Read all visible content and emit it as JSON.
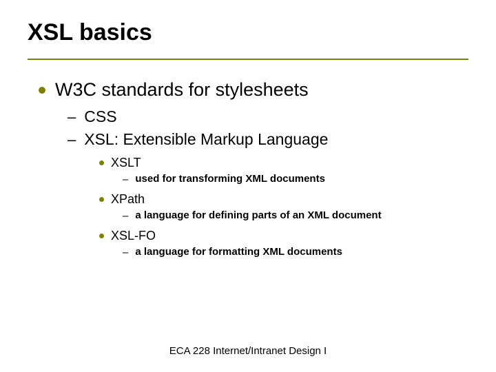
{
  "title": "XSL basics",
  "l1": {
    "text": "W3C standards for stylesheets"
  },
  "l2": [
    {
      "text": "CSS"
    },
    {
      "text": "XSL: Extensible Markup Language"
    }
  ],
  "l3": [
    {
      "text": "XSLT"
    },
    {
      "text": "XPath"
    },
    {
      "text": "XSL-FO"
    }
  ],
  "l4": [
    {
      "text": "used for transforming XML documents"
    },
    {
      "text": "a language for defining parts of an XML document"
    },
    {
      "text": "a language for formatting XML documents"
    }
  ],
  "footer": "ECA 228  Internet/Intranet Design I"
}
